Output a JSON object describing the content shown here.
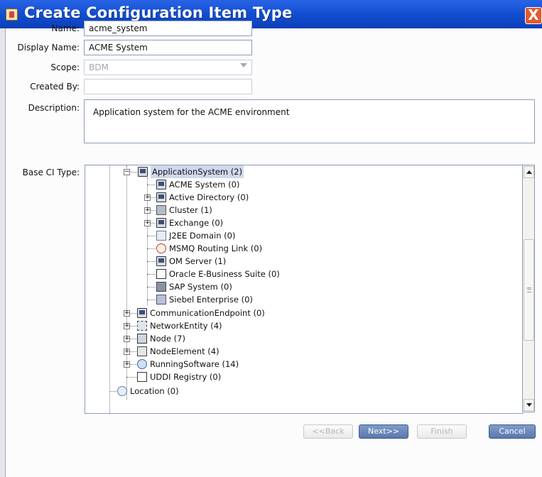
{
  "window": {
    "title": "Create Configuration Item Type",
    "close_label": "X"
  },
  "form": {
    "name_label": "Name:",
    "name_value": "acme_system",
    "display_name_label": "Display Name:",
    "display_name_value": "ACME System",
    "scope_label": "Scope:",
    "scope_value": "BDM",
    "created_by_label": "Created By:",
    "created_by_value": "",
    "description_label": "Description:",
    "description_value": "Application system for the ACME environment",
    "base_ci_type_label": "Base CI Type:"
  },
  "tree": {
    "items": [
      {
        "label": "ApplicationSystem (2)",
        "icon": "monitor-icon",
        "expanded": true,
        "selected": true
      },
      {
        "label": "ACME System (0)",
        "icon": "monitor-icon"
      },
      {
        "label": "Active Directory (0)",
        "icon": "monitor-icon",
        "collapsed": true
      },
      {
        "label": "Cluster (1)",
        "icon": "cluster-icon",
        "collapsed": true
      },
      {
        "label": "Exchange (0)",
        "icon": "monitor-icon",
        "collapsed": true
      },
      {
        "label": "J2EE Domain (0)",
        "icon": "j2ee-domain-icon"
      },
      {
        "label": "MSMQ Routing Link (0)",
        "icon": "msmq-routing-icon"
      },
      {
        "label": "OM Server (1)",
        "icon": "monitor-icon"
      },
      {
        "label": "Oracle E-Business Suite (0)",
        "icon": "oracle-home-icon"
      },
      {
        "label": "SAP System (0)",
        "icon": "sap-system-icon"
      },
      {
        "label": "Siebel Enterprise (0)",
        "icon": "siebel-icon"
      },
      {
        "label": "CommunicationEndpoint (0)",
        "icon": "monitor-icon",
        "collapsed": true
      },
      {
        "label": "NetworkEntity (4)",
        "icon": "network-entity-icon",
        "collapsed": true
      },
      {
        "label": "Node (7)",
        "icon": "node-icon",
        "collapsed": true
      },
      {
        "label": "NodeElement (4)",
        "icon": "node-element-icon",
        "collapsed": true
      },
      {
        "label": "RunningSoftware (14)",
        "icon": "running-software-icon",
        "collapsed": true
      },
      {
        "label": "UDDI Registry (0)",
        "icon": "uddi-registry-icon"
      },
      {
        "label": "Location (0)",
        "icon": "location-icon"
      }
    ]
  },
  "buttons": {
    "back": "<<Back",
    "next": "Next>>",
    "finish": "Finish",
    "cancel": "Cancel"
  }
}
